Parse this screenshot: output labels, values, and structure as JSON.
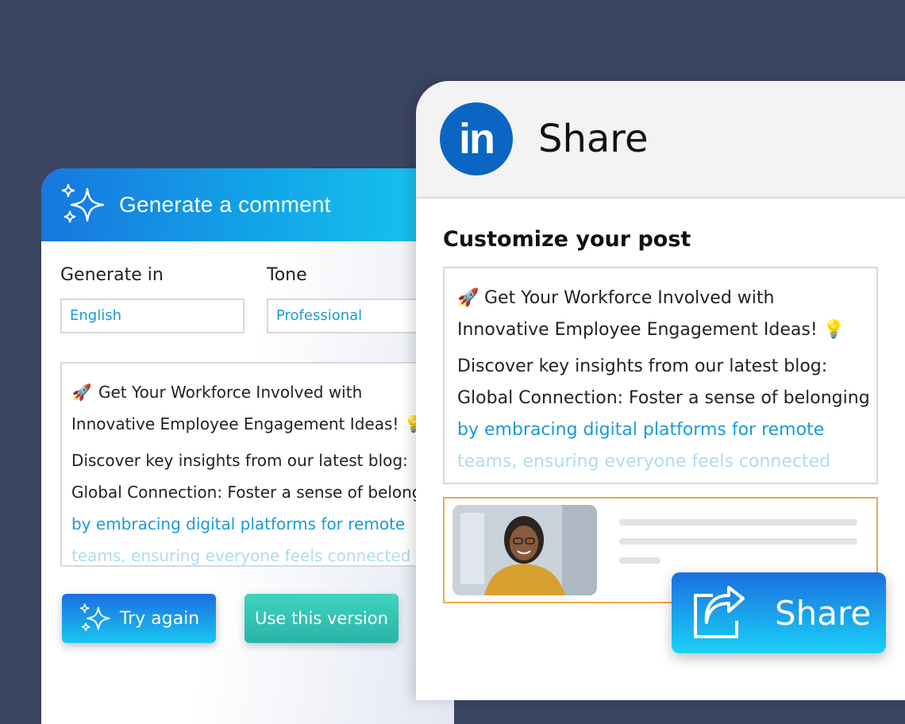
{
  "generate": {
    "title": "Generate a comment",
    "generate_in_label": "Generate in",
    "tone_label": "Tone",
    "language_value": "English",
    "tone_value": "Professional",
    "text_lines": [
      "Get Your Workforce Involved with",
      "Innovative Employee Engagement Ideas!",
      "Discover key insights from our latest blog:",
      "Global Connection: Foster a sense of belonging",
      "by embracing digital platforms for remote",
      "teams, ensuring everyone feels connected"
    ],
    "try_again_label": "Try again",
    "use_version_label": "Use this version"
  },
  "share": {
    "logo_text": "in",
    "title": "Share",
    "customize_heading": "Customize your post",
    "text_lines": [
      "Get Your Workforce Involved with",
      "Innovative Employee Engagement Ideas!",
      "Discover key insights from our latest blog:",
      "Global Connection: Foster a sense of belonging",
      "by embracing digital platforms for remote",
      "teams, ensuring everyone feels connected"
    ],
    "share_button_label": "Share"
  },
  "icons": {
    "sparkle": "sparkle-icon",
    "rocket": "rocket-icon",
    "lightbulb": "lightbulb-icon",
    "share": "share-arrow-icon"
  },
  "colors": {
    "background": "#3b4460",
    "brand_blue": "#0a66c2",
    "accent_cyan": "#1a9ad6",
    "teal_button": "#2bb3a9",
    "preview_border": "#f0a64a"
  }
}
